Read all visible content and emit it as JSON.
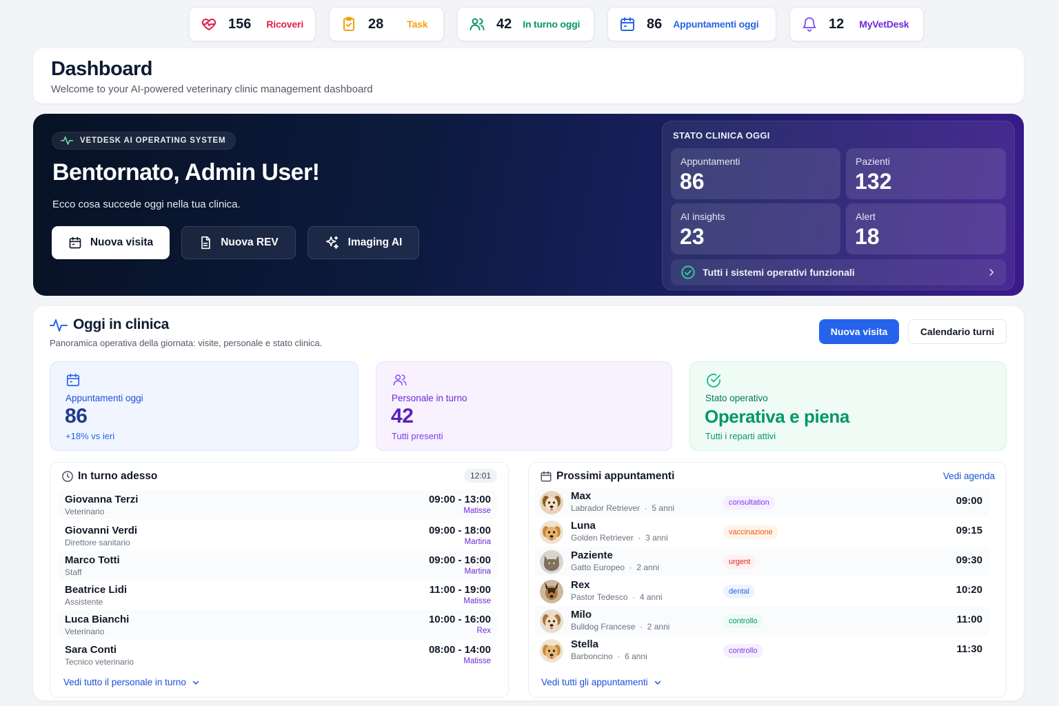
{
  "top_stats": [
    {
      "value": "156",
      "label": "Ricoveri",
      "icon": "heart-icon",
      "color": "#e11d48"
    },
    {
      "value": "28",
      "label": "Task",
      "icon": "clipboard-icon",
      "color": "#f59e0b"
    },
    {
      "value": "42",
      "label": "In turno oggi",
      "icon": "users-icon",
      "color": "#059669"
    },
    {
      "value": "86",
      "label": "Appuntamenti oggi",
      "icon": "calendar-icon",
      "color": "#2563eb"
    },
    {
      "value": "12",
      "label": "MyVetDesk",
      "icon": "bell-icon",
      "color": "#6d28d9"
    }
  ],
  "header": {
    "title": "Dashboard",
    "subtitle": "Welcome to your AI-powered veterinary clinic management dashboard"
  },
  "hero": {
    "badge": "VETDESK AI OPERATING SYSTEM",
    "title": "Bentornato, Admin User!",
    "subtitle": "Ecco cosa succede oggi nella tua clinica.",
    "buttons": [
      {
        "label": "Nuova visita",
        "icon": "calendar-icon"
      },
      {
        "label": "Nuova REV",
        "icon": "document-icon"
      },
      {
        "label": "Imaging AI",
        "icon": "sparkles-icon"
      }
    ],
    "stato": {
      "title": "STATO CLINICA OGGI",
      "tiles": [
        {
          "label": "Appuntamenti",
          "value": "86"
        },
        {
          "label": "Pazienti",
          "value": "132"
        },
        {
          "label": "AI insights",
          "value": "23"
        },
        {
          "label": "Alert",
          "value": "18"
        }
      ],
      "system_status": "Tutti i sistemi operativi funzionali"
    }
  },
  "oggi": {
    "title": "Oggi in clinica",
    "subtitle": "Panoramica operativa della giornata: visite, personale e stato clinica.",
    "primary_button": "Nuova visita",
    "secondary_button": "Calendario turni",
    "kpis": [
      {
        "label": "Appuntamenti oggi",
        "value": "86",
        "note": "+18% vs ieri",
        "icon": "calendar-icon",
        "accent": "#1d4ed8"
      },
      {
        "label": "Personale in turno",
        "value": "42",
        "note": "Tutti presenti",
        "icon": "users-icon",
        "accent": "#6d28d9"
      },
      {
        "label": "Stato operativo",
        "value": "Operativa e piena",
        "note": "Tutti i reparti attivi",
        "icon": "check-circle-icon",
        "accent": "#059669"
      }
    ],
    "in_turno": {
      "title": "In turno adesso",
      "time": "12:01",
      "staff": [
        {
          "name": "Giovanna Terzi",
          "role": "Veterinario",
          "hours": "09:00 - 13:00",
          "location": "Matisse"
        },
        {
          "name": "Giovanni Verdi",
          "role": "Direttore sanitario",
          "hours": "09:00 - 18:00",
          "location": "Martina"
        },
        {
          "name": "Marco Totti",
          "role": "Staff",
          "hours": "09:00 - 16:00",
          "location": "Martina"
        },
        {
          "name": "Beatrice Lidi",
          "role": "Assistente",
          "hours": "11:00 - 19:00",
          "location": "Matisse"
        },
        {
          "name": "Luca Bianchi",
          "role": "Veterinario",
          "hours": "10:00 - 16:00",
          "location": "Rex"
        },
        {
          "name": "Sara Conti",
          "role": "Tecnico veterinario",
          "hours": "08:00 - 14:00",
          "location": "Matisse"
        }
      ],
      "link": "Vedi tutto il personale in turno"
    },
    "appuntamenti": {
      "title": "Prossimi appuntamenti",
      "agenda_link": "Vedi agenda",
      "items": [
        {
          "name": "Max",
          "breed": "Labrador Retriever",
          "age": "5 anni",
          "tag": "consultation",
          "tag_color": "#7c3aed",
          "time": "09:00",
          "avatar": "dog-light"
        },
        {
          "name": "Luna",
          "breed": "Golden Retriever",
          "age": "3 anni",
          "tag": "vaccinazione",
          "tag_color": "#ea580c",
          "time": "09:15",
          "avatar": "dog-golden"
        },
        {
          "name": "Paziente",
          "breed": "Gatto Europeo",
          "age": "2 anni",
          "tag": "urgent",
          "tag_color": "#dc2626",
          "time": "09:30",
          "avatar": "cat-tabby"
        },
        {
          "name": "Rex",
          "breed": "Pastor Tedesco",
          "age": "4 anni",
          "tag": "dental",
          "tag_color": "#2563eb",
          "time": "10:20",
          "avatar": "dog-shepherd"
        },
        {
          "name": "Milo",
          "breed": "Bulldog Francese",
          "age": "2 anni",
          "tag": "controllo",
          "tag_color": "#059669",
          "time": "11:00",
          "avatar": "dog-light"
        },
        {
          "name": "Stella",
          "breed": "Barboncino",
          "age": "6 anni",
          "tag": "controllo",
          "tag_color": "#7c3aed",
          "time": "11:30",
          "avatar": "dog-golden"
        }
      ],
      "link": "Vedi tutti gli appuntamenti"
    }
  }
}
